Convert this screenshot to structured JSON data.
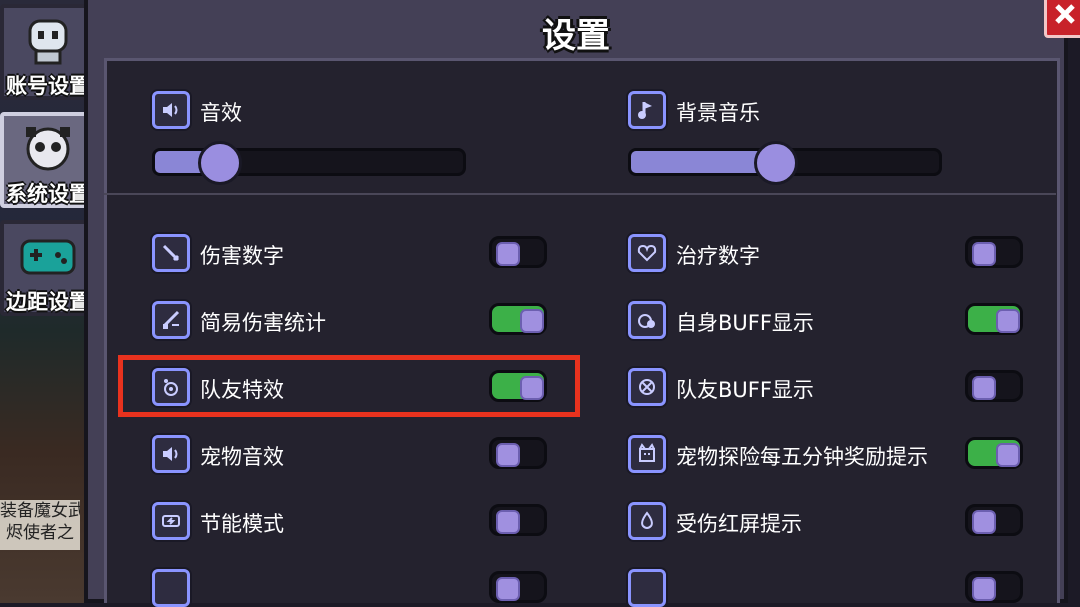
{
  "sidebar": {
    "tabs": [
      {
        "label": "账号设置",
        "icon": "robot-avatar-icon",
        "active": false
      },
      {
        "label": "系统设置",
        "icon": "panda-gear-icon",
        "active": true
      },
      {
        "label": "边距设置",
        "icon": "gamepad-icon",
        "active": false
      }
    ],
    "promo_lines": [
      "装备魔女武",
      "烬使者之"
    ]
  },
  "panel": {
    "title": "设置",
    "close_icon": "close-icon"
  },
  "audio": {
    "sound_effects": {
      "label": "音效",
      "icon": "speaker-icon",
      "value_percent": 20
    },
    "music": {
      "label": "背景音乐",
      "icon": "music-note-icon",
      "value_percent": 46
    }
  },
  "settings": {
    "left": [
      {
        "label": "伤害数字",
        "icon": "sword-icon",
        "on": false
      },
      {
        "label": "简易伤害统计",
        "icon": "sword-stats-icon",
        "on": true
      },
      {
        "label": "队友特效",
        "icon": "target-icon",
        "on": true
      },
      {
        "label": "宠物音效",
        "icon": "speaker-icon",
        "on": false
      },
      {
        "label": "节能模式",
        "icon": "battery-icon",
        "on": false
      }
    ],
    "right": [
      {
        "label": "治疗数字",
        "icon": "heart-icon",
        "on": false
      },
      {
        "label": "自身BUFF显示",
        "icon": "buff-icon",
        "on": true
      },
      {
        "label": "队友BUFF显示",
        "icon": "team-buff-icon",
        "on": false
      },
      {
        "label": "宠物探险每五分钟奖励提示",
        "icon": "pet-icon",
        "on": true
      },
      {
        "label": "受伤红屏提示",
        "icon": "drop-icon",
        "on": false
      }
    ]
  },
  "colors": {
    "accent": "#8a94ff",
    "toggle_on": "#3cb048",
    "highlight": "#e8321e"
  }
}
